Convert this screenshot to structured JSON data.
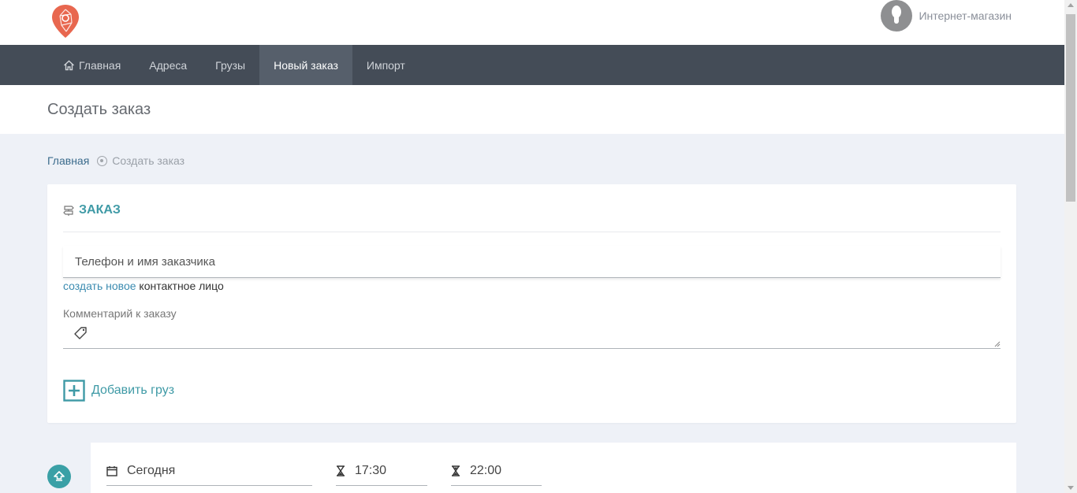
{
  "user": {
    "name": "Интернет-магазин"
  },
  "nav": {
    "items": [
      {
        "label": "Главная",
        "icon": "home-icon"
      },
      {
        "label": "Адреса"
      },
      {
        "label": "Грузы"
      },
      {
        "label": "Новый заказ",
        "active": true
      },
      {
        "label": "Импорт"
      }
    ]
  },
  "page": {
    "title": "Создать заказ"
  },
  "breadcrumb": {
    "home": "Главная",
    "current": "Создать заказ"
  },
  "order": {
    "title": "ЗАКАЗ",
    "phone_placeholder": "Телефон и имя заказчика",
    "create_link": "создать новое",
    "contact_suffix": " контактное лицо",
    "comment_label": "Комментарий к заказу",
    "add_cargo": "Добавить груз"
  },
  "pickup": {
    "date": "Сегодня",
    "time_from": "17:30",
    "time_to": "22:00"
  },
  "colors": {
    "accent": "#3f9aa6",
    "navbar": "#444c57",
    "logo": "#e8674f"
  }
}
